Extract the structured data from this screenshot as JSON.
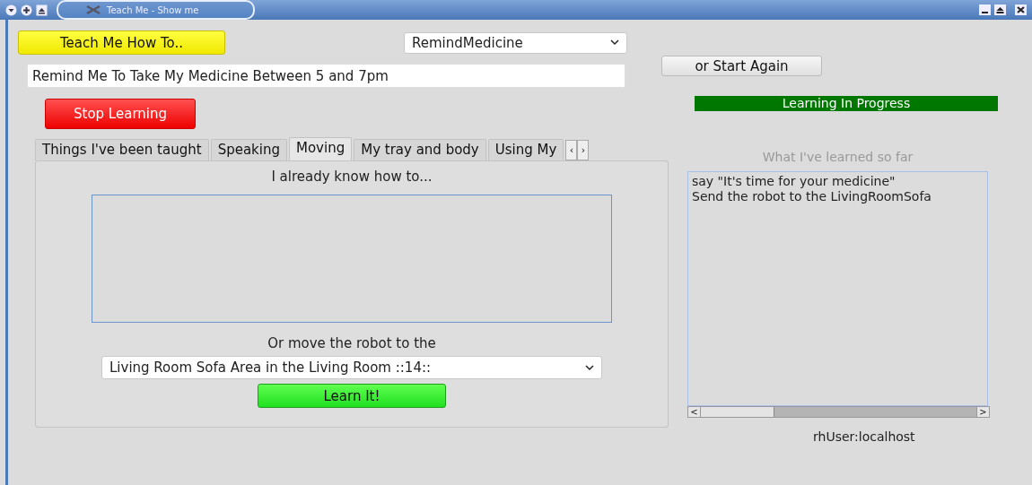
{
  "window": {
    "title": "Teach Me - Show me"
  },
  "teach_button": {
    "label": "Teach Me How To.."
  },
  "behavior_combo": {
    "value": "RemindMedicine"
  },
  "task_field": {
    "value": "Remind Me To Take My Medicine Between 5 and 7pm"
  },
  "start_again_button": {
    "label": "or Start Again"
  },
  "stop_button": {
    "label": "Stop Learning"
  },
  "status": {
    "text": "Learning In Progress"
  },
  "tabs": [
    {
      "label": "Things I've been taught",
      "selected": false
    },
    {
      "label": "Speaking",
      "selected": false
    },
    {
      "label": "Moving",
      "selected": true
    },
    {
      "label": "My tray and body",
      "selected": false
    },
    {
      "label": "Using My",
      "selected": false
    }
  ],
  "tab_scroll": {
    "left": "‹",
    "right": "›"
  },
  "moving_panel": {
    "known_heading": "I already know how to...",
    "move_heading": "Or move the robot to the",
    "location_combo": {
      "value": "Living Room Sofa Area in the Living Room ::14::"
    },
    "learn_button": {
      "label": "Learn It!"
    }
  },
  "learned": {
    "heading": "What I've learned so far",
    "lines": [
      "say \"It's time for your medicine\"",
      "Send the robot to the LivingRoomSofa"
    ],
    "scroll_left": "<",
    "scroll_right": ">"
  },
  "user": "rhUser:localhost"
}
